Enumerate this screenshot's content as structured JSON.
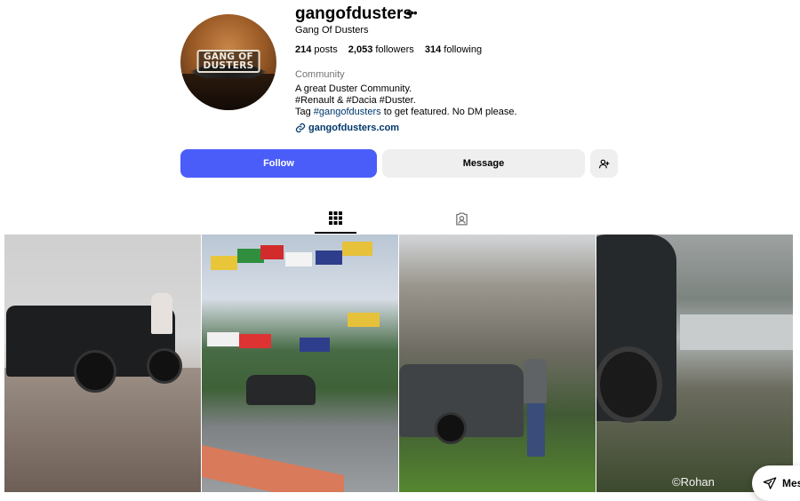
{
  "profile": {
    "username": "gangofdusters",
    "more": "•••",
    "full_name": "Gang Of Dusters",
    "avatar_text": [
      "GANG OF",
      "DUSTERS"
    ],
    "category": "Community",
    "bio": {
      "line1": "A great Duster Community.",
      "line2": "#Renault & #Dacia #Duster.",
      "line3_pre": "Tag ",
      "line3_tag": "#gangofdusters",
      "line3_post": " to get featured. No DM please."
    },
    "link": "gangofdusters.com"
  },
  "stats": [
    {
      "value": "214",
      "label": "posts"
    },
    {
      "value": "2,053",
      "label": "followers"
    },
    {
      "value": "314",
      "label": "following"
    }
  ],
  "actions": {
    "follow": "Follow",
    "message": "Message"
  },
  "tabs": [
    {
      "icon": "grid-icon",
      "active": true
    },
    {
      "icon": "tagged-icon",
      "active": false
    }
  ],
  "posts": [
    {
      "id": 1
    },
    {
      "id": 2
    },
    {
      "id": 3
    },
    {
      "id": 4
    }
  ],
  "watermark": "©Rohan",
  "floating_messages": "Mes",
  "colors": {
    "accent": "#4a5df9",
    "link": "#00376b",
    "secondary_btn": "#efefef"
  }
}
